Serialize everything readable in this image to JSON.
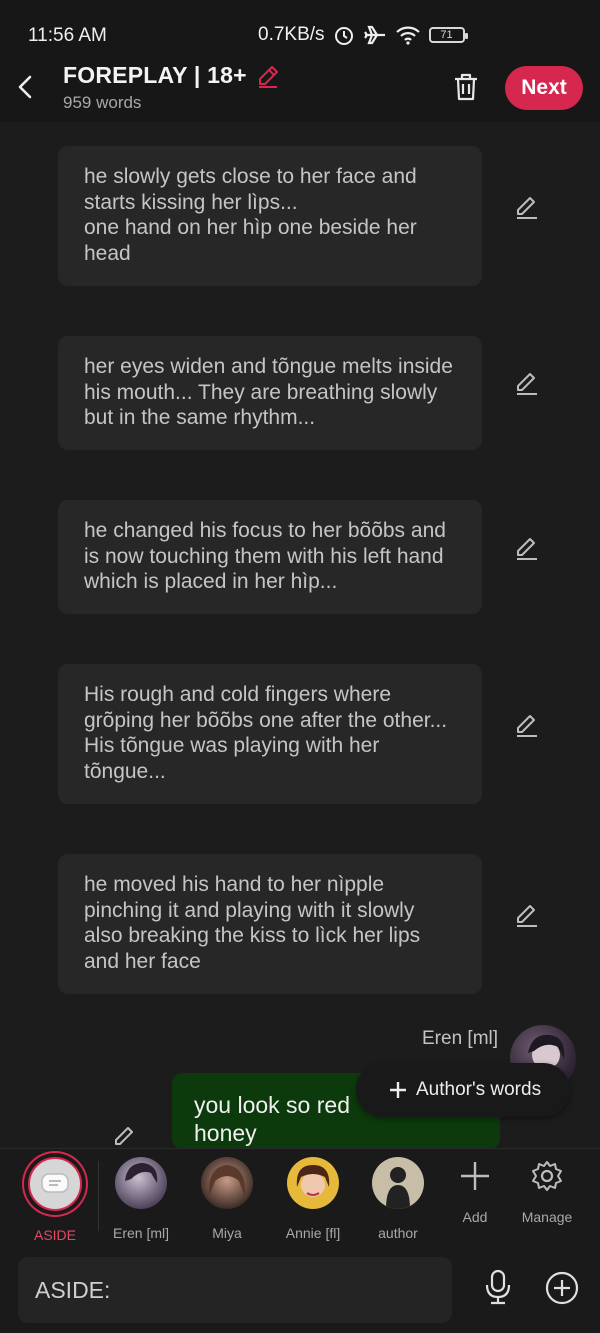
{
  "status": {
    "time": "11:56 AM",
    "speed": "0.7KB/s",
    "battery": "71"
  },
  "header": {
    "title": "FOREPLAY | 18+",
    "word_count": "959 words",
    "next_label": "Next"
  },
  "messages": [
    {
      "text": "he slowly gets close to her face and starts kissing her lìps...\none hand on her hìp one beside her head"
    },
    {
      "text": "her eyes widen and tõngue melts inside his mouth... They are breathing slowly but in the same rhythm..."
    },
    {
      "text": "he changed his focus to her bõõbs and is now touching them with his left hand which is placed in her hìp..."
    },
    {
      "text": "His rough and cold fingers where grõping her bõõbs one after the other... His tõngue was playing with her tõngue..."
    },
    {
      "text": "he moved his hand to her nìpple pinching it and playing with it slowly also breaking the kiss to lìck her lips and her face"
    }
  ],
  "speaker": {
    "name": "Eren [ml]"
  },
  "reply": {
    "text": "you look so red\nhoney"
  },
  "popup": {
    "label": "Author's words"
  },
  "characters": [
    {
      "name": "ASIDE"
    },
    {
      "name": "Eren [ml]"
    },
    {
      "name": "Miya"
    },
    {
      "name": "Annie [fl]"
    },
    {
      "name": "author"
    }
  ],
  "actions": {
    "add": "Add",
    "manage": "Manage"
  },
  "input": {
    "value": "ASIDE:"
  },
  "colors": {
    "accent": "#d6284e",
    "background": "#1c1c1c",
    "bubble": "#272727",
    "reply_bubble": "#0c3a0c"
  },
  "icons": [
    "back-arrow-icon",
    "pencil-icon",
    "trash-icon",
    "chat-bubble-icon",
    "plus-icon",
    "gear-icon",
    "microphone-icon",
    "plus-circle-icon"
  ]
}
